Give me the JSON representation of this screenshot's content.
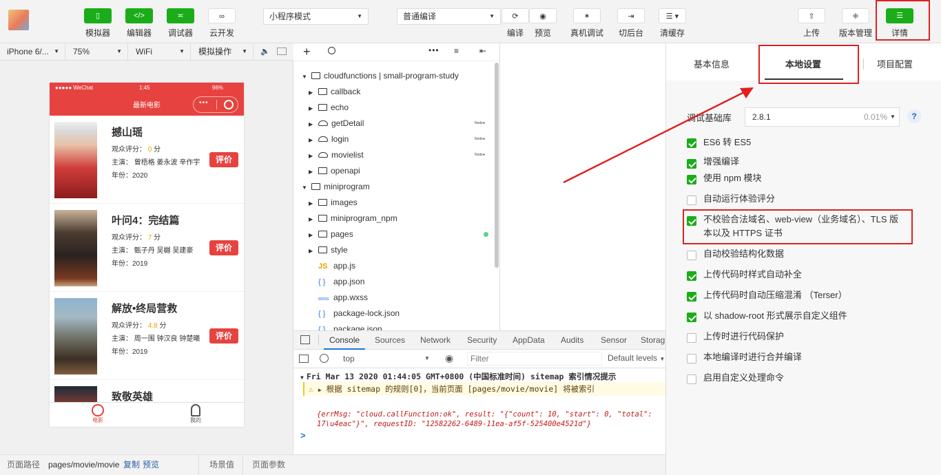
{
  "toolbar": {
    "buttons": {
      "simulator": "模拟器",
      "editor": "编辑器",
      "debugger": "调试器",
      "cloud": "云开发",
      "compile": "编译",
      "preview": "预览",
      "real_debug": "真机调试",
      "background": "切后台",
      "clear_cache": "清缓存",
      "upload": "上传",
      "version": "版本管理",
      "details": "详情"
    },
    "mode_select": "小程序模式",
    "compile_select": "普通编译",
    "accent": "#1aad19"
  },
  "devbar": {
    "device": "iPhone 6/...",
    "zoom": "75%",
    "network": "WiFi",
    "simulate": "模拟操作"
  },
  "phone": {
    "status_left": "●●●●● WeChat",
    "status_time": "1:45",
    "status_battery": "96%",
    "title": "最新电影",
    "rate_label": "评价",
    "movies": [
      {
        "title": "撼山瑶",
        "score_label": "观众评分：",
        "score": "0",
        "score_unit": "分",
        "cast": "主演： 曾梧格 姜永波 辛作宇",
        "year": "年份：2020"
      },
      {
        "title": "叶问4：完结篇",
        "score_label": "观众评分：",
        "score": "7",
        "score_unit": "分",
        "cast": "主演： 甄子丹 吴樾 吴建豪",
        "year": "年份：2019"
      },
      {
        "title": "解放•终局营救",
        "score_label": "观众评分：",
        "score": "4.8",
        "score_unit": "分",
        "cast": "主演： 周一围 钟汉良 钟楚曦",
        "year": "年份：2019"
      },
      {
        "title": "致敬英雄"
      }
    ],
    "tabs": [
      "电影",
      "我的"
    ]
  },
  "filetree": {
    "items": [
      {
        "label": "cloudfunctions | small-program-study"
      },
      {
        "label": "callback"
      },
      {
        "label": "echo"
      },
      {
        "label": "getDetail",
        "badge": "Node●"
      },
      {
        "label": "login",
        "badge": "Node●"
      },
      {
        "label": "movielist",
        "badge": "Node●"
      },
      {
        "label": "openapi"
      },
      {
        "label": "miniprogram"
      },
      {
        "label": "images"
      },
      {
        "label": "miniprogram_npm"
      },
      {
        "label": "pages"
      },
      {
        "label": "style"
      },
      {
        "label": "app.js",
        "icon": "JS"
      },
      {
        "label": "app.json",
        "icon": "{ }"
      },
      {
        "label": "app.wxss",
        "icon": "wxss"
      },
      {
        "label": "package-lock.json",
        "icon": "{ }"
      },
      {
        "label": "package.json",
        "icon": "{ }"
      }
    ]
  },
  "console": {
    "tabs": [
      "Console",
      "Sources",
      "Network",
      "Security",
      "AppData",
      "Audits",
      "Sensor",
      "Storag"
    ],
    "context": "top",
    "filter_placeholder": "Filter",
    "levels": "Default levels",
    "group_header": "Fri Mar 13 2020 01:44:05 GMT+0800 (中国标准时间) sitemap 索引情况提示",
    "warning": "根据 sitemap 的规则[0]，当前页面 [pages/movie/movie] 将被索引",
    "log_line1": "{errMsg: \"cloud.callFunction:ok\", result: \"{\"count\": 10, \"start\": 0, \"total\":",
    "log_line2": "17\\u4eac\"}\", requestID: \"12582262-6489-11ea-af5f-525400e4521d\"}",
    "prompt": ">"
  },
  "bottombar": {
    "path_label": "页面路径",
    "path_value": "pages/movie/movie",
    "copy": "复制",
    "preview": "预览",
    "scene": "场景值",
    "params": "页面参数"
  },
  "panel": {
    "tabs": [
      "基本信息",
      "本地设置",
      "项目配置"
    ],
    "active_tab": "本地设置",
    "lib_label": "调试基础库",
    "lib_version": "2.8.1",
    "lib_percent": "0.01%",
    "help": "?",
    "options": [
      {
        "label": "ES6 转 ES5",
        "checked": true
      },
      {
        "label": "增强编译",
        "checked": true
      },
      {
        "label": "使用 npm 模块",
        "checked": true
      },
      {
        "label": "自动运行体验评分",
        "checked": false
      },
      {
        "label": "不校验合法域名、web-view（业务域名）、TLS 版本以及 HTTPS 证书",
        "checked": true
      },
      {
        "label": "自动校验结构化数据",
        "checked": false
      },
      {
        "label": "上传代码时样式自动补全",
        "checked": true
      },
      {
        "label": "上传代码时自动压缩混淆 （Terser）",
        "checked": true
      },
      {
        "label": "以 shadow-root 形式展示自定义组件",
        "checked": true
      },
      {
        "label": "上传时进行代码保护",
        "checked": false
      },
      {
        "label": "本地编译时进行合并编译",
        "checked": false
      },
      {
        "label": "启用自定义处理命令",
        "checked": false
      }
    ]
  },
  "annotation_color": "#e02020"
}
